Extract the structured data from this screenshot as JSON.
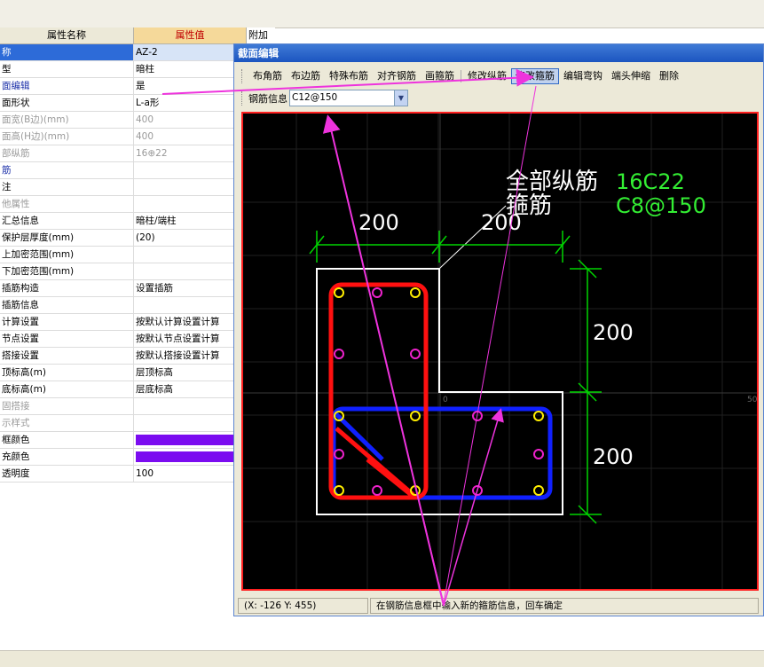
{
  "grid": {
    "header": {
      "name": "属性名称",
      "value": "属性值"
    },
    "extra_col": "附加",
    "rows": [
      {
        "n": "称",
        "v": "AZ-2",
        "style": "sel"
      },
      {
        "n": "型",
        "v": "暗柱",
        "style": ""
      },
      {
        "n": "面编辑",
        "v": "是",
        "style": "blue"
      },
      {
        "n": "面形状",
        "v": "L-a形",
        "style": ""
      },
      {
        "n": "面宽(B边)(mm)",
        "v": "400",
        "style": "gray"
      },
      {
        "n": "面高(H边)(mm)",
        "v": "400",
        "style": "gray"
      },
      {
        "n": "部纵筋",
        "v": "16⊕22",
        "style": "gray"
      },
      {
        "n": "筋",
        "v": "",
        "style": "blue"
      },
      {
        "n": "注",
        "v": "",
        "style": ""
      },
      {
        "n": "他属性",
        "v": "",
        "style": "gray"
      },
      {
        "n": "汇总信息",
        "v": "暗柱/端柱",
        "style": ""
      },
      {
        "n": "保护层厚度(mm)",
        "v": "(20)",
        "style": ""
      },
      {
        "n": "上加密范围(mm)",
        "v": "",
        "style": ""
      },
      {
        "n": "下加密范围(mm)",
        "v": "",
        "style": ""
      },
      {
        "n": "插筋构造",
        "v": "设置插筋",
        "style": ""
      },
      {
        "n": "插筋信息",
        "v": "",
        "style": ""
      },
      {
        "n": "计算设置",
        "v": "按默认计算设置计算",
        "style": ""
      },
      {
        "n": "节点设置",
        "v": "按默认节点设置计算",
        "style": ""
      },
      {
        "n": "搭接设置",
        "v": "按默认搭接设置计算",
        "style": ""
      },
      {
        "n": "顶标高(m)",
        "v": "层顶标高",
        "style": ""
      },
      {
        "n": "底标高(m)",
        "v": "层底标高",
        "style": ""
      },
      {
        "n": "固搭接",
        "v": "",
        "style": "gray"
      },
      {
        "n": "示样式",
        "v": "",
        "style": "gray"
      },
      {
        "n": "框颜色",
        "v": "",
        "style": "swatch"
      },
      {
        "n": "充颜色",
        "v": "",
        "style": "swatch"
      },
      {
        "n": "透明度",
        "v": "100",
        "style": ""
      }
    ],
    "swatch_color": "#7b0cf0"
  },
  "dialog": {
    "title": "截面编辑",
    "toolbar": [
      "布角筋",
      "布边筋",
      "特殊布筋",
      "对齐钢筋",
      "画箍筋",
      "修改纵筋",
      "修改箍筋",
      "编辑弯钩",
      "端头伸缩",
      "删除"
    ],
    "active_tool": "修改箍筋",
    "rebar_label": "钢筋信息",
    "rebar_value": "C12@150",
    "status_coords": "(X: -126 Y: 455)",
    "status_hint": "在钢筋信息框中输入新的箍筋信息，回车确定"
  },
  "drawing": {
    "label_longitudinal": "全部纵筋",
    "label_stirrup": "箍筋",
    "value_longitudinal": "16C22",
    "value_stirrup": "C8@150",
    "dim_top_left": "200",
    "dim_top_right": "200",
    "dim_right_top": "200",
    "dim_right_bottom": "200",
    "origin_mark": "0",
    "edge_mark": "50"
  },
  "colors": {
    "annotation_arrow": "#ee33dd",
    "dim_green": "#00d400",
    "stirrup_red": "#ff1010",
    "stirrup_blue": "#1020ff",
    "label_green": "#33ee33"
  }
}
